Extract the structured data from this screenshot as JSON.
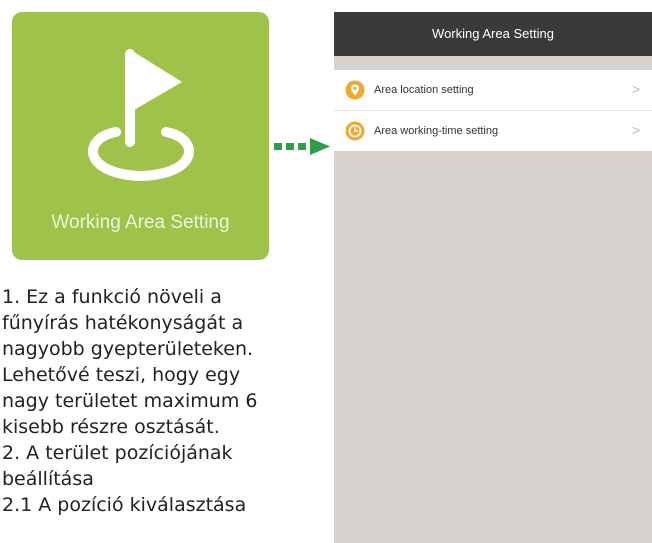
{
  "tile": {
    "label": "Working Area Setting",
    "icon": "flag-on-area-icon",
    "color": "#9fc24a"
  },
  "arrow": {
    "icon": "dashed-arrow-right-icon",
    "color": "#2e9e4a"
  },
  "description": {
    "lines": [
      "1. Ez a funkció növeli a",
      "fűnyírás hatékonyságát a",
      "nagyobb gyepterületeken.",
      "Lehetővé teszi, hogy egy",
      "nagy területet maximum 6",
      "kisebb részre osztását.",
      "2. A terület pozíciójának",
      "beállítása",
      "2.1 A pozíció kiválasztása"
    ]
  },
  "phone": {
    "title": "Working Area Setting",
    "items": [
      {
        "label": "Area location setting",
        "icon": "location-pin-icon",
        "chevron": ">"
      },
      {
        "label": "Area working-time setting",
        "icon": "clock-icon",
        "chevron": ">"
      }
    ],
    "accent": "#f0a830"
  }
}
